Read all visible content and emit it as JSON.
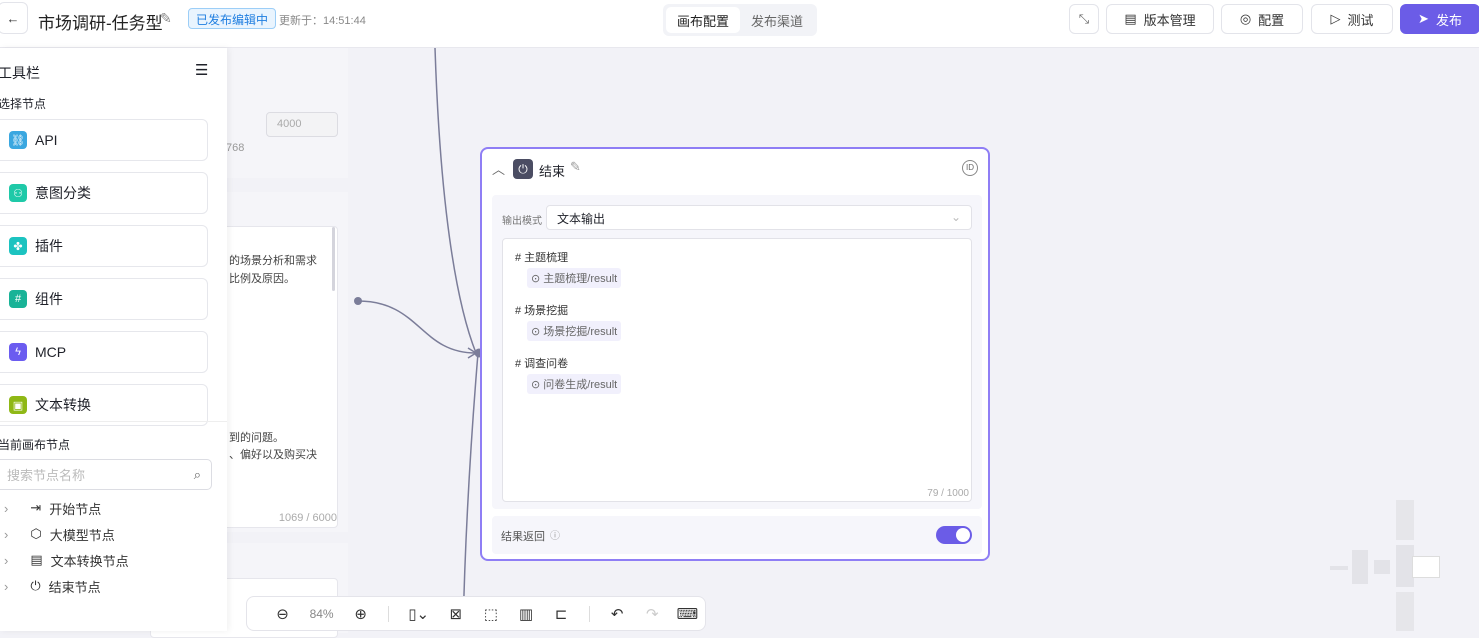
{
  "header": {
    "title": "市场调研-任务型",
    "status_badge": "已发布编辑中",
    "updated": "更新于：14:51:44",
    "tabs": [
      "画布配置",
      "发布渠道"
    ],
    "buttons": {
      "version": "版本管理",
      "config": "配置",
      "test": "测试",
      "publish": "发布"
    }
  },
  "background_node": {
    "max_value": "4000",
    "min_suffix": "768",
    "text_lines": [
      "的场景分析和需求",
      "比例及原因。",
      "到的问题。",
      "、偏好以及购买决"
    ],
    "counter": "1069 / 6000"
  },
  "sidebar": {
    "title": "工具栏",
    "section_select": "选择节点",
    "nodes": [
      {
        "label": "API",
        "color": "#3aa7e0"
      },
      {
        "label": "意图分类",
        "color": "#1fc9a8"
      },
      {
        "label": "插件",
        "color": "#1cc3c0"
      },
      {
        "label": "组件",
        "color": "#19b397"
      },
      {
        "label": "MCP",
        "color": "#6b5cf0"
      },
      {
        "label": "文本转换",
        "color": "#8fb816"
      }
    ],
    "section_canvas": "当前画布节点",
    "search_placeholder": "搜索节点名称",
    "tree": [
      {
        "label": "开始节点",
        "icon": "enter-icon"
      },
      {
        "label": "大模型节点",
        "icon": "model-icon"
      },
      {
        "label": "文本转换节点",
        "icon": "layout-icon"
      },
      {
        "label": "结束节点",
        "icon": "power-icon"
      }
    ]
  },
  "end_node": {
    "title": "结束",
    "output_mode_label": "输出模式",
    "output_mode_value": "文本输出",
    "sections": [
      {
        "heading": "# 主题梳理",
        "ref": "主题梳理/result"
      },
      {
        "heading": "# 场景挖掘",
        "ref": "场景挖掘/result"
      },
      {
        "heading": "# 调查问卷",
        "ref": "问卷生成/result"
      }
    ],
    "counter": "79 / 1000",
    "return_label": "结果返回",
    "return_enabled": true
  },
  "toolbar": {
    "zoom": "84%"
  },
  "colors": {
    "accent": "#6b5ce7",
    "node_border": "#8f7ef5"
  }
}
